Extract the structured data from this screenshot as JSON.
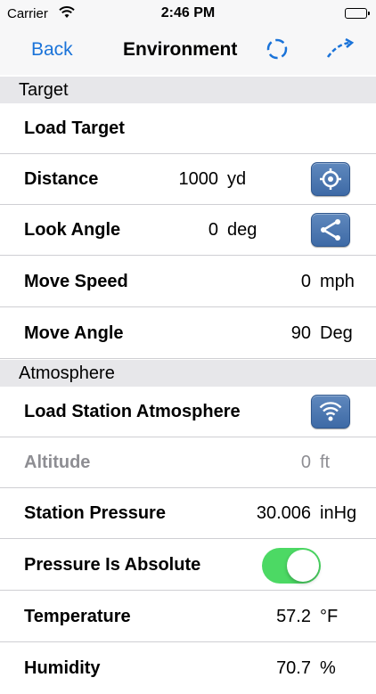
{
  "status_bar": {
    "carrier": "Carrier",
    "time": "2:46 PM"
  },
  "nav": {
    "back_label": "Back",
    "title": "Environment"
  },
  "sections": {
    "target": "Target",
    "atmosphere": "Atmosphere"
  },
  "rows": {
    "load_target": {
      "label": "Load Target"
    },
    "distance": {
      "label": "Distance",
      "value": "1000",
      "unit": "yd"
    },
    "look_angle": {
      "label": "Look Angle",
      "value": "0",
      "unit": "deg"
    },
    "move_speed": {
      "label": "Move Speed",
      "value": "0",
      "unit": "mph"
    },
    "move_angle": {
      "label": "Move Angle",
      "value": "90",
      "unit": "Deg"
    },
    "load_station": {
      "label": "Load Station Atmosphere"
    },
    "altitude": {
      "label": "Altitude",
      "value": "0",
      "unit": "ft"
    },
    "station_pressure": {
      "label": "Station Pressure",
      "value": "30.006",
      "unit": "inHg"
    },
    "pressure_absolute": {
      "label": "Pressure Is Absolute",
      "toggle_on": true
    },
    "temperature": {
      "label": "Temperature",
      "value": "57.2",
      "unit": "°F"
    },
    "humidity": {
      "label": "Humidity",
      "value": "70.7",
      "unit": "%"
    }
  },
  "colors": {
    "accent": "#1a73d9",
    "toggle_on": "#4cd964",
    "section_bg": "#e7e7ea"
  },
  "icons": [
    "wifi-icon",
    "battery-icon",
    "target-circle-icon",
    "trajectory-icon",
    "crosshair-icon",
    "angle-icon",
    "wifi-signal-icon"
  ]
}
